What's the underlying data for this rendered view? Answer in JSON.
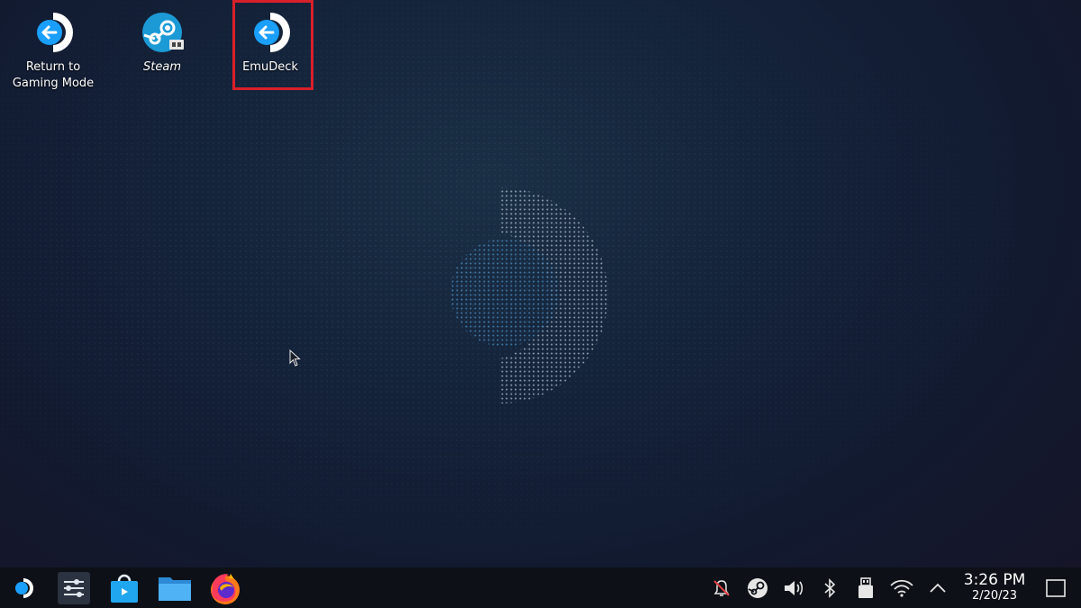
{
  "desktop": {
    "icons": [
      {
        "label": "Return to\nGaming Mode",
        "icon": "steamdeck-return-icon"
      },
      {
        "label": "Steam",
        "icon": "steam-icon"
      },
      {
        "label": "EmuDeck",
        "icon": "steamdeck-return-icon"
      }
    ],
    "highlighted_icon": "EmuDeck"
  },
  "taskbar": {
    "launchers": [
      "application-launcher-icon",
      "system-settings-icon",
      "discover-store-icon",
      "file-manager-icon",
      "firefox-icon"
    ],
    "tray": [
      "notifications-muted-icon",
      "steam-tray-icon",
      "volume-icon",
      "bluetooth-icon",
      "usb-device-icon",
      "wifi-icon",
      "expand-tray-icon"
    ],
    "clock": {
      "time": "3:26 PM",
      "date": "2/20/23"
    },
    "show_desktop": "show-desktop-icon"
  },
  "colors": {
    "highlight": "#d8202a",
    "taskbar": "#0d1117",
    "steamdeck_blue": "#1a9fff"
  }
}
